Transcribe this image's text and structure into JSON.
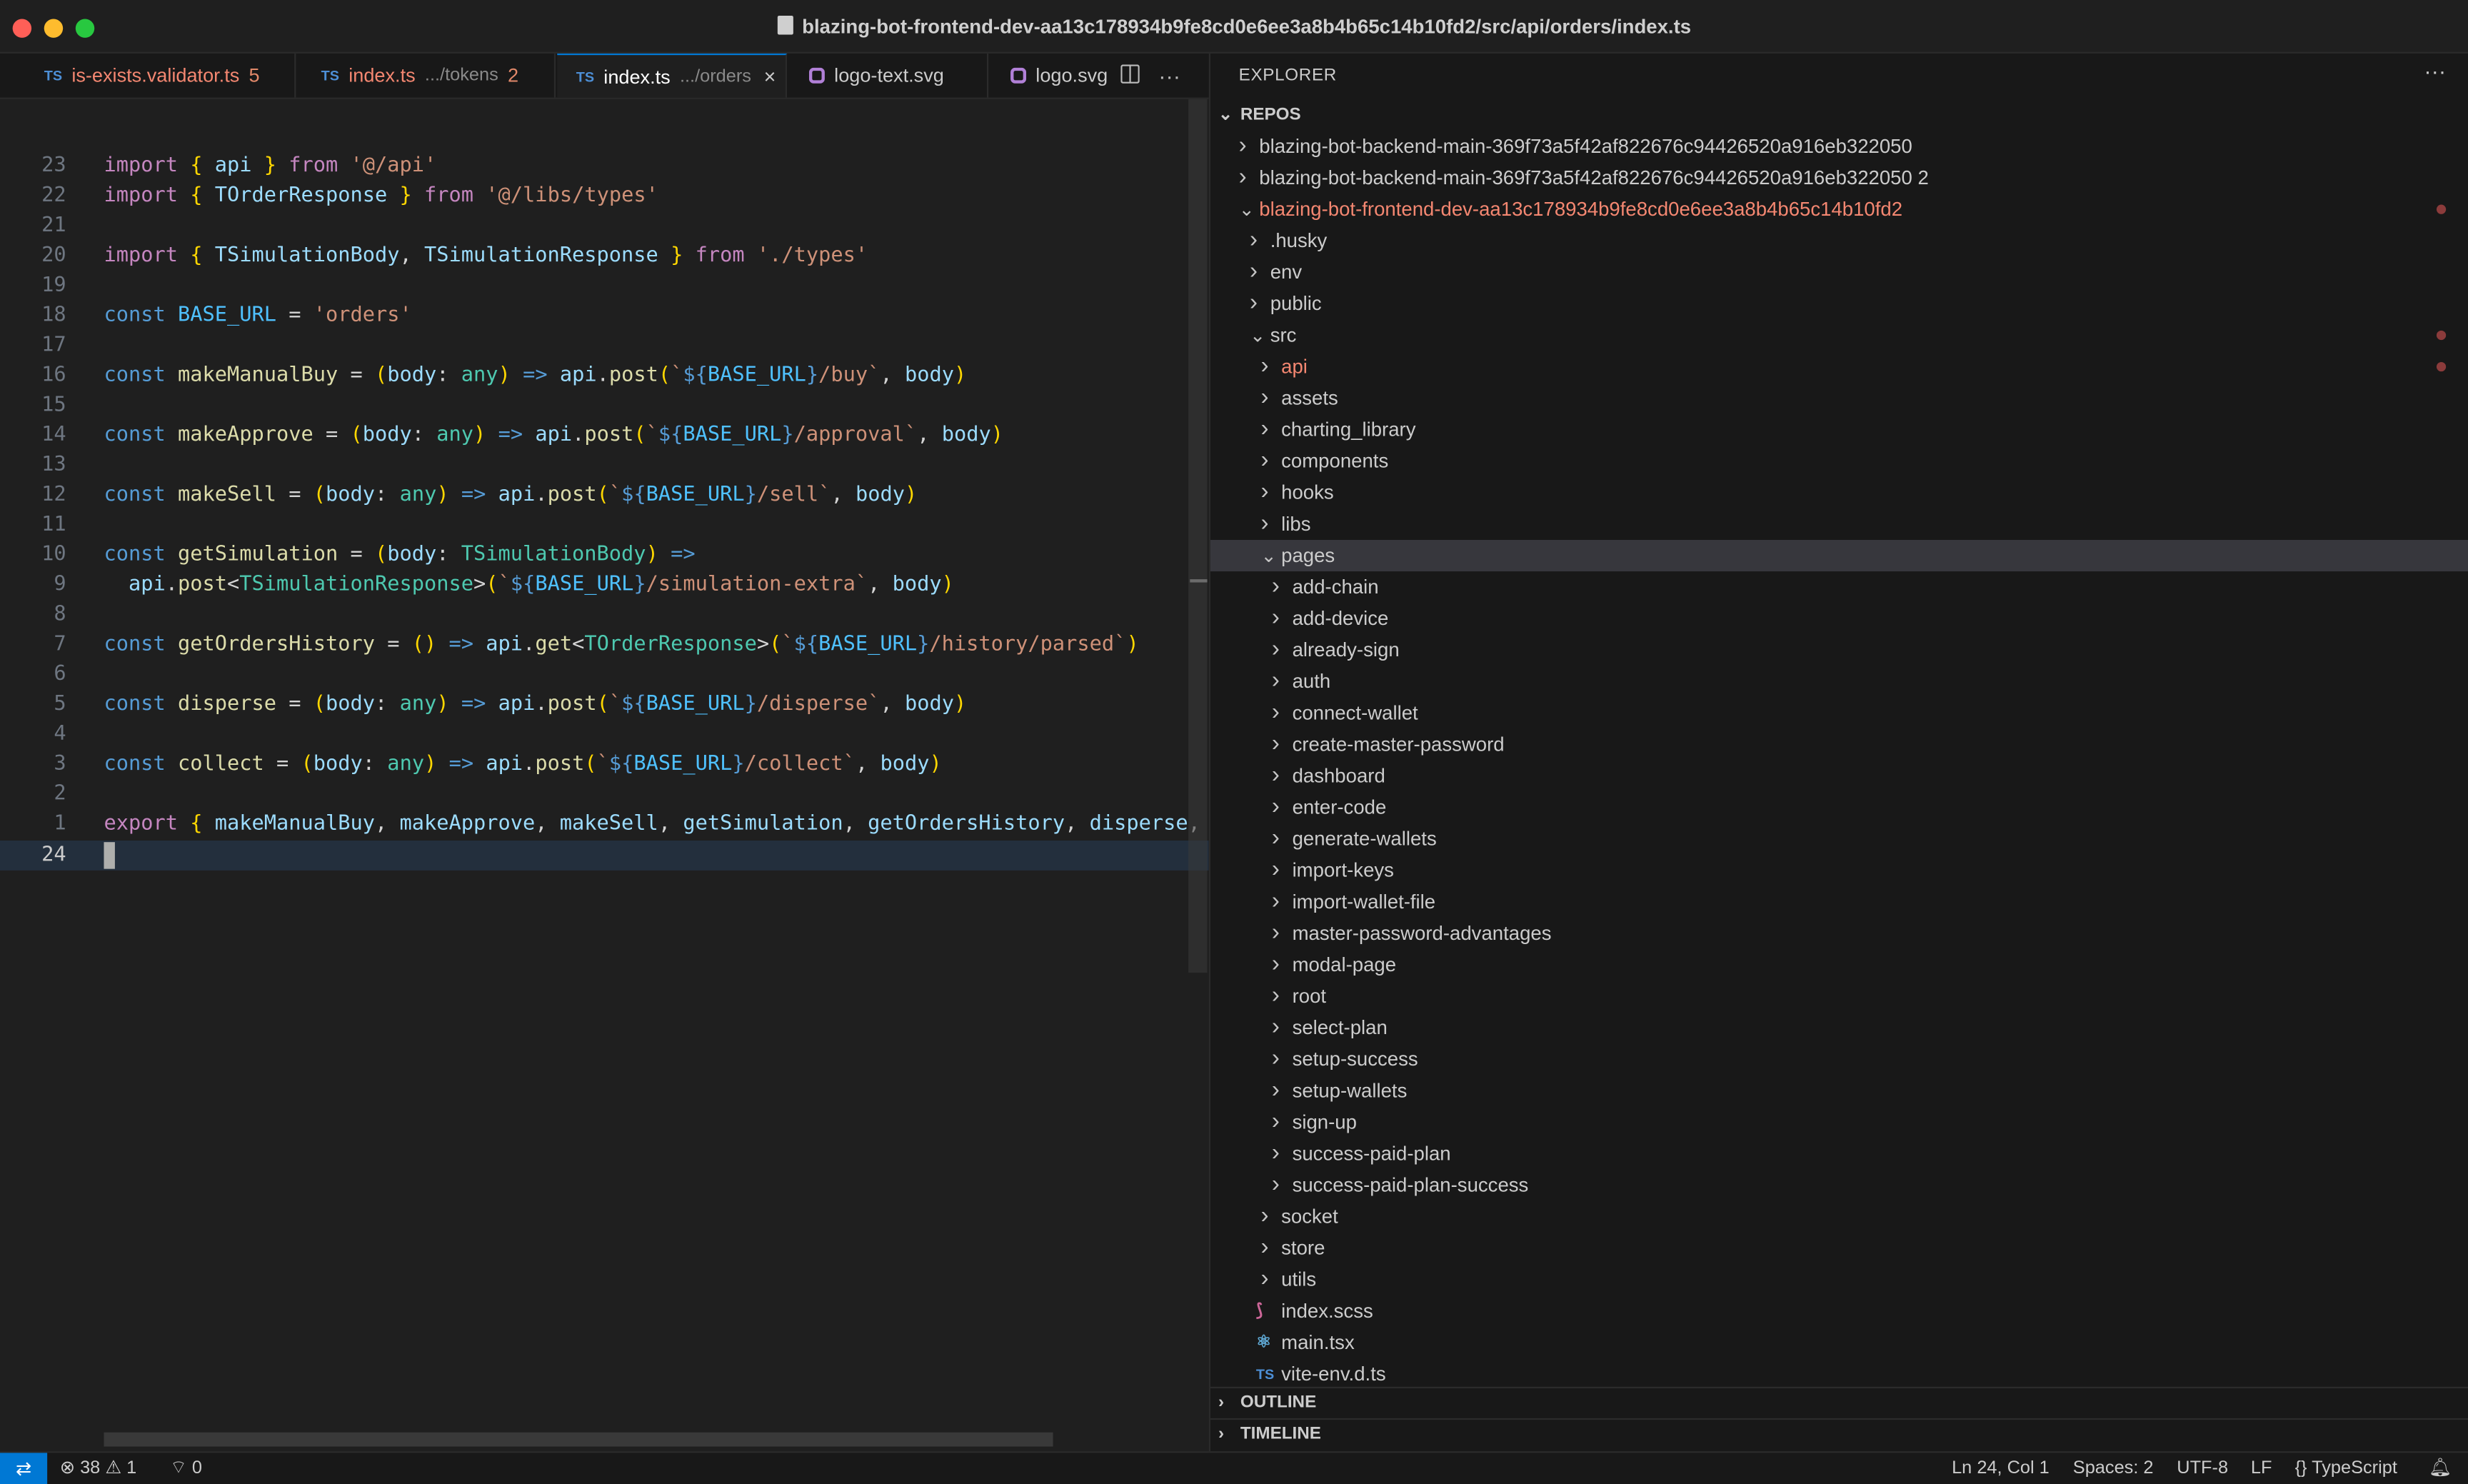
{
  "window": {
    "title": "blazing-bot-frontend-dev-aa13c178934b9fe8cd0e6ee3a8b4b65c14b10fd2/src/api/orders/index.ts",
    "lights": {
      "close": "#ff5f57",
      "minimize": "#febc2e",
      "maximize": "#28c840"
    }
  },
  "tabs": [
    {
      "badge": "TS",
      "label": "is-exists.validator.ts",
      "desc": "",
      "count": "5"
    },
    {
      "badge": "TS",
      "label": "index.ts",
      "desc": ".../tokens",
      "count": "2"
    },
    {
      "badge": "TS",
      "label": "index.ts",
      "desc": ".../orders",
      "count": ""
    },
    {
      "badge": "svg",
      "label": "logo-text.svg",
      "desc": "",
      "count": ""
    },
    {
      "badge": "svg",
      "label": "logo.svg",
      "desc": "",
      "count": ""
    }
  ],
  "tab_actions": {
    "split": "▯▯",
    "more": "···",
    "close": "×"
  },
  "editor": {
    "line_numbers": [
      "23",
      "22",
      "21",
      "20",
      "19",
      "18",
      "17",
      "16",
      "15",
      "14",
      "13",
      "12",
      "11",
      "10",
      "9",
      "8",
      "7",
      "6",
      "5",
      "4",
      "3",
      "2",
      "1",
      "24"
    ],
    "lines": [
      "import { api } from '@/api'",
      "import { TOrderResponse } from '@/libs/types'",
      "",
      "import { TSimulationBody, TSimulationResponse } from './types'",
      "",
      "const BASE_URL = 'orders'",
      "",
      "const makeManualBuy = (body: any) => api.post(`${BASE_URL}/buy`, body)",
      "",
      "const makeApprove = (body: any) => api.post(`${BASE_URL}/approval`, body)",
      "",
      "const makeSell = (body: any) => api.post(`${BASE_URL}/sell`, body)",
      "",
      "const getSimulation = (body: TSimulationBody) =>",
      "  api.post<TSimulationResponse>(`${BASE_URL}/simulation-extra`, body)",
      "",
      "const getOrdersHistory = () => api.get<TOrderResponse>(`${BASE_URL}/history/parsed`)",
      "",
      "const disperse = (body: any) => api.post(`${BASE_URL}/disperse`, body)",
      "",
      "const collect = (body: any) => api.post(`${BASE_URL}/collect`, body)",
      "",
      "export { makeManualBuy, makeApprove, makeSell, getSimulation, getOrdersHistory, disperse, co",
      ""
    ]
  },
  "explorer": {
    "header": "EXPLORER",
    "more": "···",
    "section": "REPOS",
    "tree": [
      {
        "label": "blazing-bot-backend-main-369f73a5f42af822676c94426520a916eb322050",
        "kind": "folder",
        "open": false
      },
      {
        "label": "blazing-bot-backend-main-369f73a5f42af822676c94426520a916eb322050 2",
        "kind": "folder",
        "open": false
      },
      {
        "label": "blazing-bot-frontend-dev-aa13c178934b9fe8cd0e6ee3a8b4b65c14b10fd2",
        "kind": "folder",
        "open": true
      },
      {
        "label": ".husky",
        "kind": "folder",
        "open": false
      },
      {
        "label": "env",
        "kind": "folder",
        "open": false
      },
      {
        "label": "public",
        "kind": "folder",
        "open": false
      },
      {
        "label": "src",
        "kind": "folder",
        "open": true
      },
      {
        "label": "api",
        "kind": "folder",
        "open": false
      },
      {
        "label": "assets",
        "kind": "folder",
        "open": false
      },
      {
        "label": "charting_library",
        "kind": "folder",
        "open": false
      },
      {
        "label": "components",
        "kind": "folder",
        "open": false
      },
      {
        "label": "hooks",
        "kind": "folder",
        "open": false
      },
      {
        "label": "libs",
        "kind": "folder",
        "open": false
      },
      {
        "label": "pages",
        "kind": "folder",
        "open": true
      },
      {
        "label": "add-chain",
        "kind": "folder",
        "open": false
      },
      {
        "label": "add-device",
        "kind": "folder",
        "open": false
      },
      {
        "label": "already-sign",
        "kind": "folder",
        "open": false
      },
      {
        "label": "auth",
        "kind": "folder",
        "open": false
      },
      {
        "label": "connect-wallet",
        "kind": "folder",
        "open": false
      },
      {
        "label": "create-master-password",
        "kind": "folder",
        "open": false
      },
      {
        "label": "dashboard",
        "kind": "folder",
        "open": false
      },
      {
        "label": "enter-code",
        "kind": "folder",
        "open": false
      },
      {
        "label": "generate-wallets",
        "kind": "folder",
        "open": false
      },
      {
        "label": "import-keys",
        "kind": "folder",
        "open": false
      },
      {
        "label": "import-wallet-file",
        "kind": "folder",
        "open": false
      },
      {
        "label": "master-password-advantages",
        "kind": "folder",
        "open": false
      },
      {
        "label": "modal-page",
        "kind": "folder",
        "open": false
      },
      {
        "label": "root",
        "kind": "folder",
        "open": false
      },
      {
        "label": "select-plan",
        "kind": "folder",
        "open": false
      },
      {
        "label": "setup-success",
        "kind": "folder",
        "open": false
      },
      {
        "label": "setup-wallets",
        "kind": "folder",
        "open": false
      },
      {
        "label": "sign-up",
        "kind": "folder",
        "open": false
      },
      {
        "label": "success-paid-plan",
        "kind": "folder",
        "open": false
      },
      {
        "label": "success-paid-plan-success",
        "kind": "folder",
        "open": false
      },
      {
        "label": "socket",
        "kind": "folder",
        "open": false
      },
      {
        "label": "store",
        "kind": "folder",
        "open": false
      },
      {
        "label": "utils",
        "kind": "folder",
        "open": false
      },
      {
        "label": "index.scss",
        "kind": "file",
        "icon": "sass-icon"
      },
      {
        "label": "main.tsx",
        "kind": "file",
        "icon": "react-icon"
      },
      {
        "label": "vite-env.d.ts",
        "kind": "file",
        "icon": "typescript-icon",
        "icon_text": "TS"
      }
    ],
    "outline": "OUTLINE",
    "timeline": "TIMELINE"
  },
  "statusbar": {
    "remote": "⇄",
    "errors": "38",
    "warnings": "1",
    "ports": "0",
    "position": "Ln 24, Col 1",
    "spaces": "Spaces: 2",
    "encoding": "UTF-8",
    "eol": "LF",
    "language": "TypeScript",
    "error_color": "#f48771",
    "accent": "#0078d4"
  }
}
